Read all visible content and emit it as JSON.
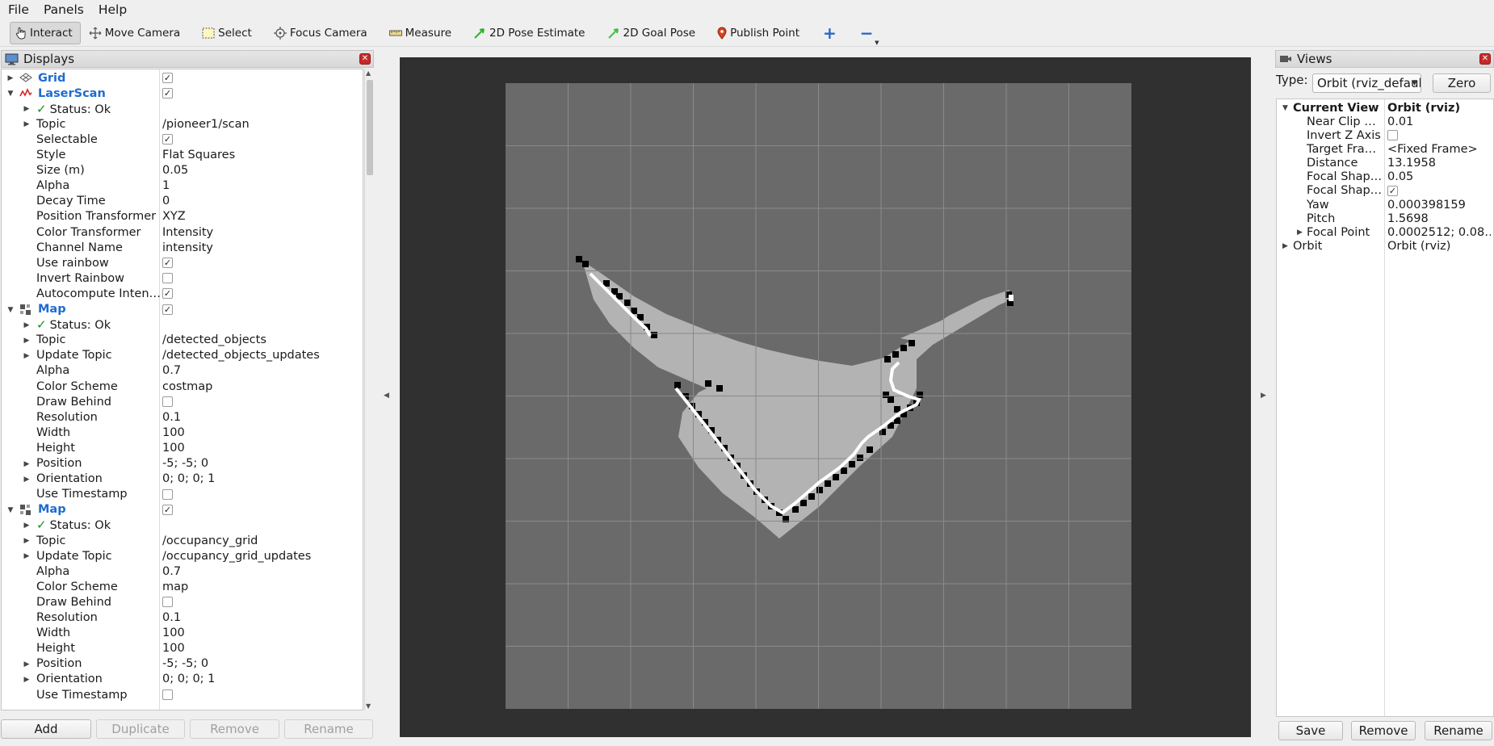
{
  "menu": {
    "file": "File",
    "panels": "Panels",
    "help": "Help"
  },
  "toolbar": {
    "interact": "Interact",
    "move_camera": "Move Camera",
    "select": "Select",
    "focus_camera": "Focus Camera",
    "measure": "Measure",
    "pose_estimate": "2D Pose Estimate",
    "goal_pose": "2D Goal Pose",
    "publish_point": "Publish Point",
    "add_glyph": "+",
    "remove_glyph": "−"
  },
  "displays": {
    "title": "Displays",
    "rows": [
      {
        "name": "Grid",
        "value": "",
        "check": true,
        "group": true,
        "icon": "grid-icon",
        "depth": 0
      },
      {
        "name": "LaserScan",
        "value": "",
        "check": true,
        "group": true,
        "icon": "laserscan-icon",
        "depth": 0,
        "expanded": true
      },
      {
        "name": "Status: Ok",
        "value": "",
        "status": true,
        "depth": 1
      },
      {
        "name": "Topic",
        "value": "/pioneer1/scan",
        "depth": 1,
        "expandable": true
      },
      {
        "name": "Selectable",
        "value": "",
        "check": true,
        "depth": 1
      },
      {
        "name": "Style",
        "value": "Flat Squares",
        "depth": 1
      },
      {
        "name": "Size (m)",
        "value": "0.05",
        "depth": 1
      },
      {
        "name": "Alpha",
        "value": "1",
        "depth": 1
      },
      {
        "name": "Decay Time",
        "value": "0",
        "depth": 1
      },
      {
        "name": "Position Transformer",
        "value": "XYZ",
        "depth": 1
      },
      {
        "name": "Color Transformer",
        "value": "Intensity",
        "depth": 1
      },
      {
        "name": "Channel Name",
        "value": "intensity",
        "depth": 1
      },
      {
        "name": "Use rainbow",
        "value": "",
        "check": true,
        "depth": 1
      },
      {
        "name": "Invert Rainbow",
        "value": "",
        "check": false,
        "depth": 1
      },
      {
        "name": "Autocompute Inten…",
        "value": "",
        "check": true,
        "depth": 1
      },
      {
        "name": "Map",
        "value": "",
        "check": true,
        "group": true,
        "icon": "map-icon",
        "depth": 0,
        "expanded": true
      },
      {
        "name": "Status: Ok",
        "value": "",
        "status": true,
        "depth": 1
      },
      {
        "name": "Topic",
        "value": "/detected_objects",
        "depth": 1,
        "expandable": true
      },
      {
        "name": "Update Topic",
        "value": "/detected_objects_updates",
        "depth": 1,
        "expandable": true
      },
      {
        "name": "Alpha",
        "value": "0.7",
        "depth": 1
      },
      {
        "name": "Color Scheme",
        "value": "costmap",
        "depth": 1
      },
      {
        "name": "Draw Behind",
        "value": "",
        "check": false,
        "depth": 1
      },
      {
        "name": "Resolution",
        "value": "0.1",
        "depth": 1
      },
      {
        "name": "Width",
        "value": "100",
        "depth": 1
      },
      {
        "name": "Height",
        "value": "100",
        "depth": 1
      },
      {
        "name": "Position",
        "value": "-5; -5; 0",
        "depth": 1,
        "expandable": true
      },
      {
        "name": "Orientation",
        "value": "0; 0; 0; 1",
        "depth": 1,
        "expandable": true
      },
      {
        "name": "Use Timestamp",
        "value": "",
        "check": false,
        "depth": 1
      },
      {
        "name": "Map",
        "value": "",
        "check": true,
        "group": true,
        "icon": "map-icon",
        "depth": 0,
        "expanded": true
      },
      {
        "name": "Status: Ok",
        "value": "",
        "status": true,
        "depth": 1
      },
      {
        "name": "Topic",
        "value": "/occupancy_grid",
        "depth": 1,
        "expandable": true
      },
      {
        "name": "Update Topic",
        "value": "/occupancy_grid_updates",
        "depth": 1,
        "expandable": true
      },
      {
        "name": "Alpha",
        "value": "0.7",
        "depth": 1
      },
      {
        "name": "Color Scheme",
        "value": "map",
        "depth": 1
      },
      {
        "name": "Draw Behind",
        "value": "",
        "check": false,
        "depth": 1
      },
      {
        "name": "Resolution",
        "value": "0.1",
        "depth": 1
      },
      {
        "name": "Width",
        "value": "100",
        "depth": 1
      },
      {
        "name": "Height",
        "value": "100",
        "depth": 1
      },
      {
        "name": "Position",
        "value": "-5; -5; 0",
        "depth": 1,
        "expandable": true
      },
      {
        "name": "Orientation",
        "value": "0; 0; 0; 1",
        "depth": 1,
        "expandable": true
      },
      {
        "name": "Use Timestamp",
        "value": "",
        "check": false,
        "depth": 1
      }
    ],
    "buttons": {
      "add": "Add",
      "duplicate": "Duplicate",
      "remove": "Remove",
      "rename": "Rename"
    }
  },
  "views": {
    "title": "Views",
    "type_label": "Type:",
    "type_value": "Orbit (rviz_default",
    "zero": "Zero",
    "rows": [
      {
        "name": "Current View",
        "value": "Orbit (rviz)",
        "bold": true,
        "depth": 0,
        "expanded": true
      },
      {
        "name": "Near Clip …",
        "value": "0.01",
        "depth": 1
      },
      {
        "name": "Invert Z Axis",
        "value": "",
        "check": false,
        "depth": 1
      },
      {
        "name": "Target Fra…",
        "value": "<Fixed Frame>",
        "depth": 1
      },
      {
        "name": "Distance",
        "value": "13.1958",
        "depth": 1
      },
      {
        "name": "Focal Shap…",
        "value": "0.05",
        "depth": 1
      },
      {
        "name": "Focal Shap…",
        "value": "",
        "check": true,
        "depth": 1
      },
      {
        "name": "Yaw",
        "value": "0.000398159",
        "depth": 1
      },
      {
        "name": "Pitch",
        "value": "1.5698",
        "depth": 1
      },
      {
        "name": "Focal Point",
        "value": "0.0002512; 0.08…",
        "depth": 1,
        "expandable": true
      },
      {
        "name": "Orbit",
        "value": "Orbit (rviz)",
        "depth": 0,
        "expandable": true
      }
    ],
    "buttons": {
      "save": "Save",
      "remove": "Remove",
      "rename": "Rename"
    }
  },
  "colors": {
    "accent": "#1f6bd0",
    "ok": "#15911d",
    "viewport_bg": "#303030",
    "grid_bg": "#6a6a6a",
    "free": "#b3b3b3",
    "occupied": "#000000",
    "scan": "#ffffff"
  }
}
